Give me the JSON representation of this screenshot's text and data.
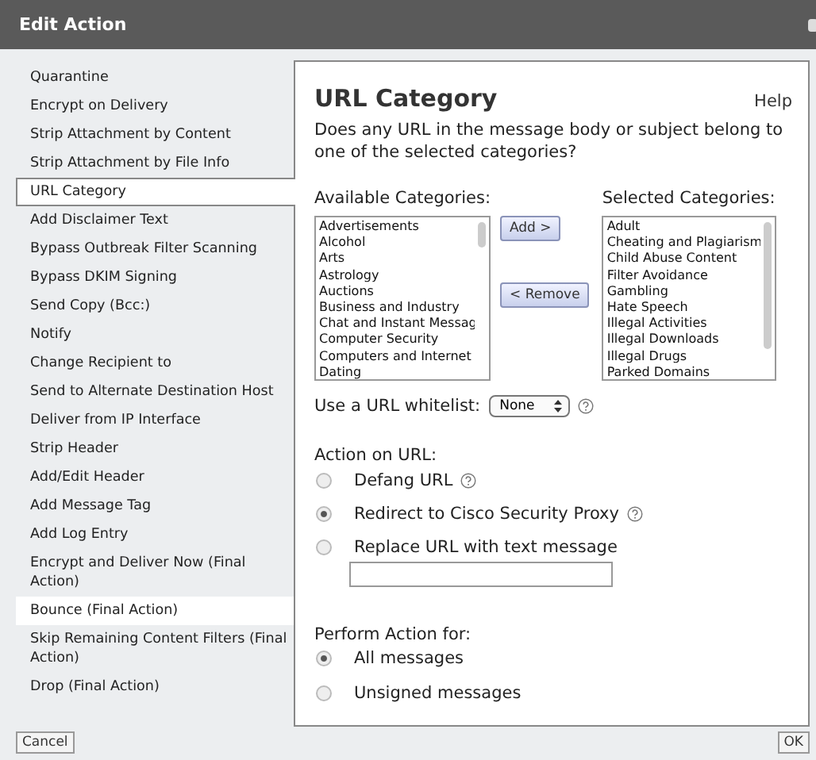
{
  "window": {
    "title": "Edit Action"
  },
  "sidebar": {
    "items": [
      {
        "label": "Quarantine",
        "selected": false,
        "highlighted": false
      },
      {
        "label": "Encrypt on Delivery",
        "selected": false,
        "highlighted": false
      },
      {
        "label": "Strip Attachment by Content",
        "selected": false,
        "highlighted": false
      },
      {
        "label": "Strip Attachment by File Info",
        "selected": false,
        "highlighted": false
      },
      {
        "label": "URL Category",
        "selected": true,
        "highlighted": false
      },
      {
        "label": "Add Disclaimer Text",
        "selected": false,
        "highlighted": false
      },
      {
        "label": "Bypass Outbreak Filter Scanning",
        "selected": false,
        "highlighted": false
      },
      {
        "label": "Bypass DKIM Signing",
        "selected": false,
        "highlighted": false
      },
      {
        "label": "Send Copy (Bcc:)",
        "selected": false,
        "highlighted": false
      },
      {
        "label": "Notify",
        "selected": false,
        "highlighted": false
      },
      {
        "label": "Change Recipient to",
        "selected": false,
        "highlighted": false
      },
      {
        "label": "Send to Alternate Destination Host",
        "selected": false,
        "highlighted": false
      },
      {
        "label": "Deliver from IP Interface",
        "selected": false,
        "highlighted": false
      },
      {
        "label": "Strip Header",
        "selected": false,
        "highlighted": false
      },
      {
        "label": "Add/Edit Header",
        "selected": false,
        "highlighted": false
      },
      {
        "label": "Add Message Tag",
        "selected": false,
        "highlighted": false
      },
      {
        "label": "Add Log Entry",
        "selected": false,
        "highlighted": false
      },
      {
        "label": "Encrypt and Deliver Now (Final Action)",
        "selected": false,
        "highlighted": false
      },
      {
        "label": "Bounce (Final Action)",
        "selected": false,
        "highlighted": true
      },
      {
        "label": "Skip Remaining Content Filters (Final Action)",
        "selected": false,
        "highlighted": false
      },
      {
        "label": "Drop (Final Action)",
        "selected": false,
        "highlighted": false
      }
    ]
  },
  "panel": {
    "title": "URL Category",
    "help": "Help",
    "question": "Does any URL in the message body or subject belong to one of the selected categories?",
    "available": {
      "label": "Available Categories:",
      "items": [
        "Advertisements",
        "Alcohol",
        "Arts",
        "Astrology",
        "Auctions",
        "Business and Industry",
        "Chat and Instant Messag",
        "Computer Security",
        "Computers and Internet",
        "Dating"
      ]
    },
    "add_button": "Add >",
    "remove_button": "< Remove",
    "selected_list": {
      "label": "Selected Categories:",
      "items": [
        "Adult",
        "Cheating and Plagiarism",
        "Child Abuse Content",
        "Filter Avoidance",
        "Gambling",
        "Hate Speech",
        "Illegal Activities",
        "Illegal Downloads",
        "Illegal Drugs",
        "Parked Domains"
      ]
    },
    "whitelist": {
      "label": "Use a URL whitelist:",
      "value": "None"
    },
    "action_on_url": {
      "label": "Action on URL:",
      "options": [
        {
          "label": "Defang URL",
          "selected": false,
          "help": true
        },
        {
          "label": "Redirect to Cisco Security Proxy",
          "selected": true,
          "help": true
        },
        {
          "label": "Replace URL with text message",
          "selected": false,
          "help": false,
          "kind": "text"
        }
      ]
    },
    "perform_for": {
      "label": "Perform Action for:",
      "options": [
        {
          "label": "All messages",
          "selected": true
        },
        {
          "label": "Unsigned messages",
          "selected": false
        }
      ]
    }
  },
  "buttons": {
    "cancel": "Cancel",
    "ok": "OK"
  }
}
